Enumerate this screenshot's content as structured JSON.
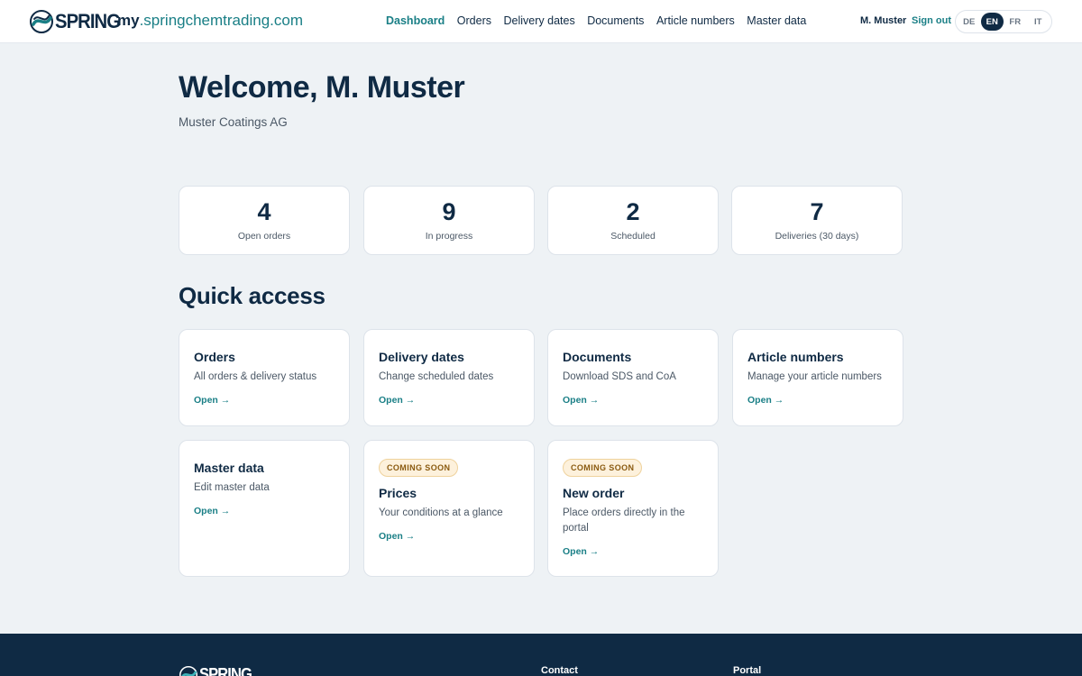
{
  "header": {
    "logo_text": "SPRING",
    "domain_prefix": "my",
    "domain_rest": ".springchemtrading.com",
    "nav": [
      {
        "label": "Dashboard",
        "active": true
      },
      {
        "label": "Orders",
        "active": false
      },
      {
        "label": "Delivery dates",
        "active": false
      },
      {
        "label": "Documents",
        "active": false
      },
      {
        "label": "Article numbers",
        "active": false
      },
      {
        "label": "Master data",
        "active": false
      }
    ],
    "user": "M. Muster",
    "sign_out": "Sign out",
    "languages": [
      "DE",
      "EN",
      "FR",
      "IT"
    ],
    "active_language": "EN"
  },
  "welcome": {
    "title": "Welcome, M. Muster",
    "company": "Muster Coatings AG"
  },
  "stats": [
    {
      "value": "4",
      "label": "Open orders"
    },
    {
      "value": "9",
      "label": "In progress"
    },
    {
      "value": "2",
      "label": "Scheduled"
    },
    {
      "value": "7",
      "label": "Deliveries (30 days)"
    }
  ],
  "quick_access": {
    "title": "Quick access",
    "cards": [
      {
        "title": "Orders",
        "desc": "All orders & delivery status",
        "link": "Open →"
      },
      {
        "title": "Delivery dates",
        "desc": "Change scheduled dates",
        "link": "Open →"
      },
      {
        "title": "Documents",
        "desc": "Download SDS and CoA",
        "link": "Open →"
      },
      {
        "title": "Article numbers",
        "desc": "Manage your article numbers",
        "link": "Open →"
      },
      {
        "title": "Master data",
        "desc": "Edit master data",
        "link": "Open →"
      },
      {
        "badge": "COMING SOON",
        "title": "Prices",
        "desc": "Your conditions at a glance",
        "link": "Open →"
      },
      {
        "badge": "COMING SOON",
        "title": "New order",
        "desc": "Place orders directly in the portal",
        "link": "Open →"
      }
    ]
  },
  "footer": {
    "logo_text": "SPRING",
    "col_contact": "Contact",
    "col_portal": "Portal"
  },
  "colors": {
    "brand_navy": "#0f2a44",
    "brand_teal": "#1a7f86",
    "badge_bg": "#fdf1dc"
  }
}
